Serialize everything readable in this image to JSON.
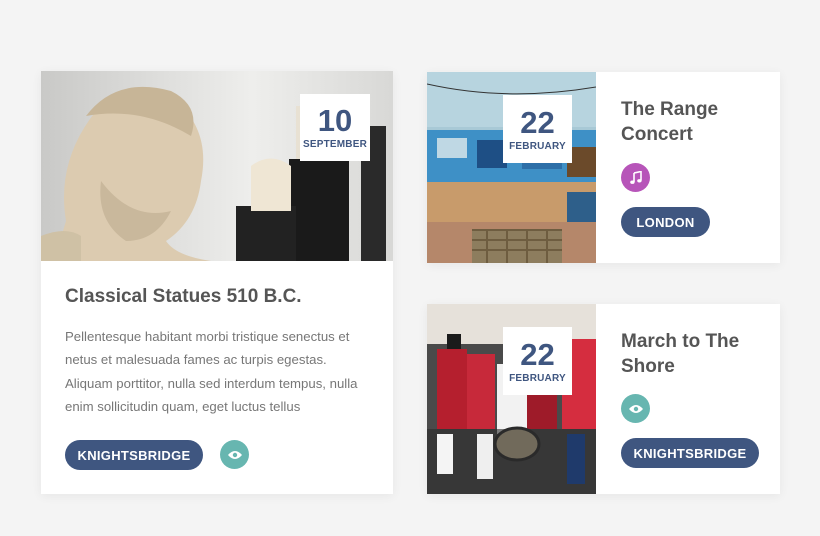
{
  "cards": [
    {
      "day": "10",
      "month": "SEPTEMBER",
      "title": "Classical Statues 510 B.C.",
      "description": "Pellentesque habitant morbi tristique senectus et netus et malesuada fames ac turpis egestas. Aliquam porttitor, nulla sed interdum tempus, nulla enim sollicitudin quam, eget luctus tellus",
      "location": "KNIGHTSBRIDGE",
      "icon": "eye-icon",
      "icon_color": "#67b6b0"
    },
    {
      "day": "22",
      "month": "FEBRUARY",
      "title": "The Range Concert",
      "location": "LONDON",
      "icon": "music-note-icon",
      "icon_color": "#b755b9"
    },
    {
      "day": "22",
      "month": "FEBRUARY",
      "title": "March to The Shore",
      "location": "KNIGHTSBRIDGE",
      "icon": "eye-icon",
      "icon_color": "#67b6b0"
    }
  ],
  "colors": {
    "accent": "#3f5680",
    "teal": "#67b6b0",
    "purple": "#b755b9",
    "background": "#f4f4f4"
  }
}
